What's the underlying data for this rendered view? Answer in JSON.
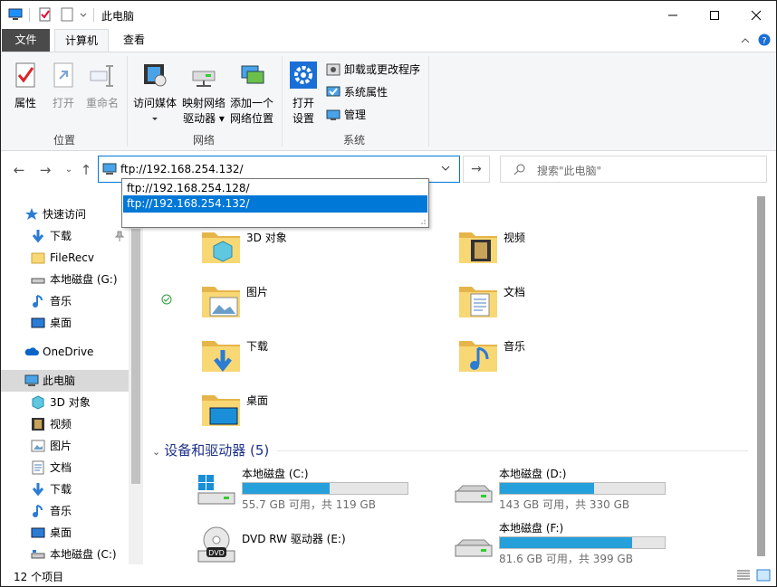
{
  "window": {
    "title": "此电脑"
  },
  "tabs": {
    "file": "文件",
    "computer": "计算机",
    "view": "查看"
  },
  "ribbon": {
    "location": {
      "label": "位置",
      "properties": "属性",
      "open": "打开",
      "rename": "重命名"
    },
    "network": {
      "label": "网络",
      "access_media": "访问媒体",
      "map_drive_line1": "映射网络",
      "map_drive_line2": "驱动器",
      "add_location_line1": "添加一个",
      "add_location_line2": "网络位置"
    },
    "system": {
      "label": "系统",
      "open_settings_line1": "打开",
      "open_settings_line2": "设置",
      "uninstall": "卸载或更改程序",
      "system_properties": "系统属性",
      "manage": "管理"
    }
  },
  "address": {
    "value": "ftp://192.168.254.132/",
    "suggestions": [
      "ftp://192.168.254.128/",
      "ftp://192.168.254.132/"
    ],
    "selected_index": 1
  },
  "search": {
    "placeholder": "搜索\"此电脑\""
  },
  "nav": {
    "quick_access": "快速访问",
    "quick_items": [
      "下载",
      "FileRecv",
      "本地磁盘 (G:)",
      "音乐",
      "桌面"
    ],
    "onedrive": "OneDrive",
    "this_pc": "此电脑",
    "pc_items": [
      "3D 对象",
      "视频",
      "图片",
      "文档",
      "下载",
      "音乐",
      "桌面",
      "本地磁盘 (C:)"
    ]
  },
  "folders": [
    "3D 对象",
    "视频",
    "图片",
    "文档",
    "下载",
    "音乐",
    "桌面"
  ],
  "devices": {
    "header": "设备和驱动器 (5)",
    "drives": [
      {
        "name": "本地磁盘 (C:)",
        "info": "55.7 GB 可用，共 119 GB",
        "used_fraction": 0.53
      },
      {
        "name": "本地磁盘 (D:)",
        "info": "143 GB 可用，共 330 GB",
        "used_fraction": 0.57
      },
      {
        "name": "DVD RW 驱动器 (E:)",
        "info": "",
        "used_fraction": null
      },
      {
        "name": "本地磁盘 (F:)",
        "info": "81.6 GB 可用，共 399 GB",
        "used_fraction": 0.8
      }
    ]
  },
  "status": {
    "count": "12 个项目"
  },
  "colors": {
    "accent": "#0078d7",
    "drive_fill": "#26a0da",
    "folder": "#f8d775",
    "folder_dark": "#e6b54a"
  }
}
